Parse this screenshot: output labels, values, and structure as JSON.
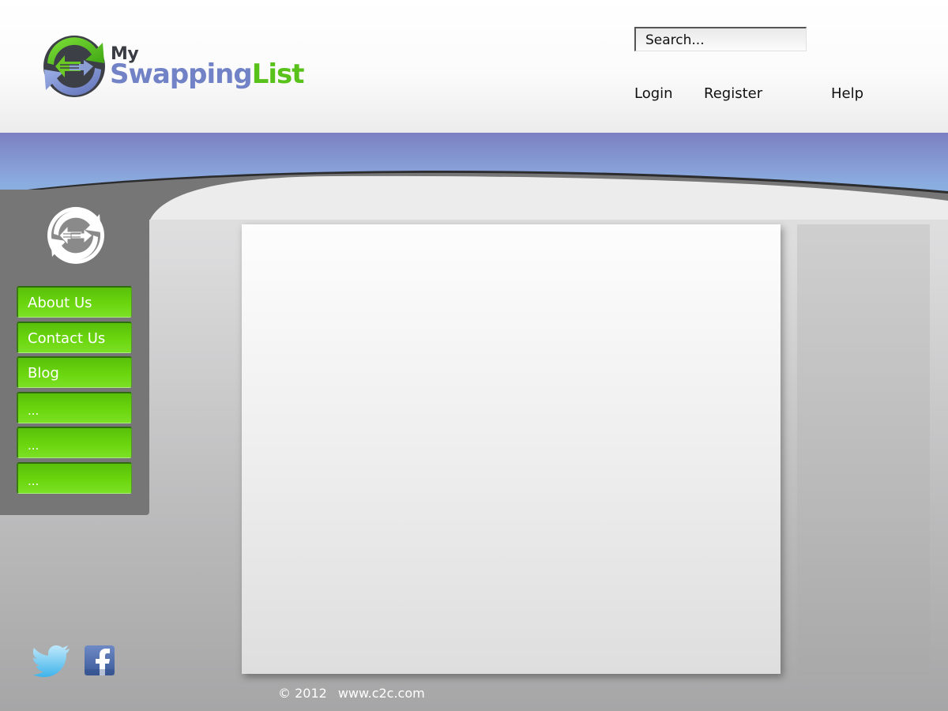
{
  "brand": {
    "word_small": "My",
    "word_big_part1": "Swapping",
    "word_big_part2": "List",
    "colors": {
      "swapping": "#7282c6",
      "list": "#59c21a",
      "my": "#3a3c44",
      "nav_green": "#66cf0d",
      "band_blue": "#7e86c6",
      "sidebar_gray": "#767676"
    }
  },
  "header": {
    "search_placeholder": "Search...",
    "links": {
      "login": "Login",
      "register": "Register",
      "help": "Help"
    }
  },
  "sidebar": {
    "logo_icon": "swap-arrows-icon",
    "nav": [
      {
        "label": "About Us"
      },
      {
        "label": "Contact Us"
      },
      {
        "label": "Blog"
      },
      {
        "label": "..."
      },
      {
        "label": "..."
      },
      {
        "label": "..."
      }
    ]
  },
  "social": {
    "icons": [
      "twitter-icon",
      "facebook-icon"
    ]
  },
  "footer": {
    "copyright": "© 2012",
    "site": "www.c2c.com"
  }
}
